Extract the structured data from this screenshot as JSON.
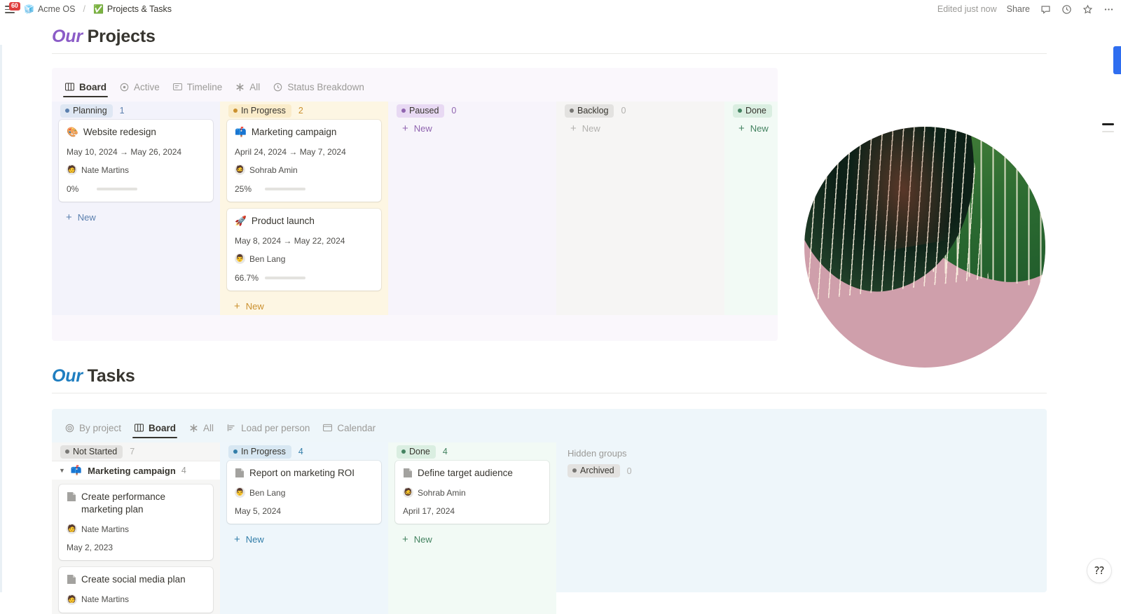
{
  "topbar": {
    "menu_badge": "60",
    "workspace_icon": "cube-icon",
    "workspace": "Acme OS",
    "separator": "/",
    "page_icon": "green-check-icon",
    "page": "Projects & Tasks",
    "edited": "Edited just now",
    "share": "Share",
    "icons": [
      "comment-icon",
      "clock-icon",
      "star-icon",
      "more-icon"
    ]
  },
  "projects": {
    "heading_accent": "Our",
    "heading_rest": " Projects",
    "accent_color": "#8b5cc7",
    "tabs": [
      {
        "label": "Board",
        "icon": "board-icon",
        "active": true
      },
      {
        "label": "Active",
        "icon": "target-icon",
        "active": false
      },
      {
        "label": "Timeline",
        "icon": "timeline-icon",
        "active": false
      },
      {
        "label": "All",
        "icon": "asterisk-icon",
        "active": false
      },
      {
        "label": "Status Breakdown",
        "icon": "clock-icon",
        "active": false
      }
    ],
    "columns": [
      {
        "status": "Planning",
        "count": "1",
        "pill_bg": "#dfe7f3",
        "dot": "#5a7fae",
        "count_color": "#5a7fae",
        "col_bg": "#f3f3fb",
        "new_label": "New",
        "new_color": "#5a7fae",
        "cards": [
          {
            "emoji": "🎨",
            "title": "Website redesign",
            "dates": "May 10, 2024 → May 26, 2024",
            "assignee": "Nate Martins",
            "avatar": "🧑",
            "progress_label": "0%",
            "progress": 0
          }
        ]
      },
      {
        "status": "In Progress",
        "count": "2",
        "pill_bg": "#faecca",
        "dot": "#cb912f",
        "count_color": "#cb912f",
        "col_bg": "#fdf6e3",
        "new_label": "New",
        "new_color": "#cb912f",
        "cards": [
          {
            "emoji": "📫",
            "title": "Marketing campaign",
            "dates": "April 24, 2024 → May 7, 2024",
            "assignee": "Sohrab Amin",
            "avatar": "🧔",
            "progress_label": "25%",
            "progress": 25
          },
          {
            "emoji": "🚀",
            "title": "Product launch",
            "dates": "May 8, 2024 → May 22, 2024",
            "assignee": "Ben Lang",
            "avatar": "👨",
            "progress_label": "66.7%",
            "progress": 66.7
          }
        ]
      },
      {
        "status": "Paused",
        "count": "0",
        "pill_bg": "#e8d9f3",
        "dot": "#9065b0",
        "count_color": "#9065b0",
        "col_bg": "#f7f4fb",
        "new_label": "New",
        "new_color": "#9065b0",
        "cards": []
      },
      {
        "status": "Backlog",
        "count": "0",
        "pill_bg": "#e3e2e0",
        "dot": "#787774",
        "count_color": "#b2b1ae",
        "col_bg": "#f6f5f4",
        "new_label": "New",
        "new_color": "#b2b1ae",
        "cards": []
      },
      {
        "status": "Done",
        "count": "",
        "pill_bg": "#daeee1",
        "dot": "#448361",
        "count_color": "#448361",
        "col_bg": "#f2faf5",
        "new_label": "New",
        "new_color": "#448361",
        "cards": []
      }
    ]
  },
  "tasks": {
    "heading_accent": "Our",
    "heading_rest": " Tasks",
    "accent_color": "#1f7ec0",
    "tabs": [
      {
        "label": "By project",
        "icon": "target-icon",
        "active": false
      },
      {
        "label": "Board",
        "icon": "board-icon",
        "active": true
      },
      {
        "label": "All",
        "icon": "asterisk-icon",
        "active": false
      },
      {
        "label": "Load per person",
        "icon": "bars-icon",
        "active": false
      },
      {
        "label": "Calendar",
        "icon": "calendar-icon",
        "active": false
      }
    ],
    "columns": [
      {
        "status": "Not Started",
        "count": "7",
        "pill_bg": "#e3e2e0",
        "dot": "#787774",
        "count_color": "#b2b1ae",
        "col_bg": "#f6f6f5",
        "group": {
          "triangle": "▼",
          "emoji": "📫",
          "name": "Marketing campaign",
          "count": "4"
        },
        "cards": [
          {
            "icon": "page-icon",
            "title": "Create performance marketing plan",
            "assignee": "Nate Martins",
            "avatar": "🧑",
            "date": "May 2, 2023"
          },
          {
            "icon": "page-icon",
            "title": "Create social media plan",
            "assignee": "Nate Martins",
            "avatar": "🧑",
            "date": ""
          }
        ],
        "new_label": "",
        "new_color": "#b2b1ae"
      },
      {
        "status": "In Progress",
        "count": "4",
        "pill_bg": "#d7e7f2",
        "dot": "#337ea9",
        "count_color": "#337ea9",
        "col_bg": "#eef6fb",
        "cards": [
          {
            "icon": "page-icon",
            "title": "Report on marketing ROI",
            "assignee": "Ben Lang",
            "avatar": "👨",
            "date": "May 5, 2024"
          }
        ],
        "new_label": "New",
        "new_color": "#337ea9"
      },
      {
        "status": "Done",
        "count": "4",
        "pill_bg": "#daeee1",
        "dot": "#448361",
        "count_color": "#448361",
        "col_bg": "#f2faf5",
        "cards": [
          {
            "icon": "page-icon",
            "title": "Define target audience",
            "assignee": "Sohrab Amin",
            "avatar": "🧔",
            "date": "April 17, 2024"
          }
        ],
        "new_label": "New",
        "new_color": "#448361"
      }
    ],
    "hidden_groups": {
      "label": "Hidden groups",
      "items": [
        {
          "status": "Archived",
          "count": "0",
          "pill_bg": "#e3e2e0",
          "dot": "#787774",
          "count_color": "#b2b1ae"
        }
      ]
    }
  },
  "helper": {
    "icon": "sparkle-question-icon",
    "glyph": "⁇"
  }
}
